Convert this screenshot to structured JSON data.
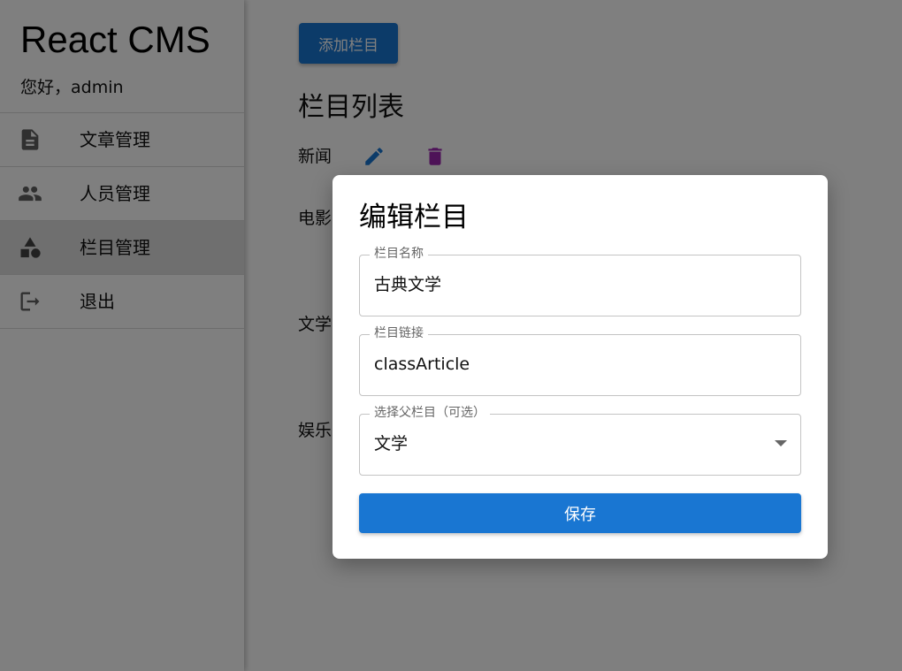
{
  "app": {
    "brand": "React CMS",
    "greeting": "您好，admin"
  },
  "sidebar": {
    "items": [
      {
        "label": "文章管理",
        "icon": "article-icon",
        "active": false
      },
      {
        "label": "人员管理",
        "icon": "people-icon",
        "active": false
      },
      {
        "label": "栏目管理",
        "icon": "category-icon",
        "active": true
      },
      {
        "label": "退出",
        "icon": "logout-icon",
        "active": false
      }
    ]
  },
  "main": {
    "add_button_label": "添加栏目",
    "section_title": "栏目列表",
    "categories": [
      {
        "name": "新闻"
      },
      {
        "name": "电影"
      },
      {
        "name": "文学"
      },
      {
        "name": "娱乐"
      }
    ]
  },
  "dialog": {
    "title": "编辑栏目",
    "name_field": {
      "label": "栏目名称",
      "value": "古典文学"
    },
    "link_field": {
      "label": "栏目链接",
      "value": "classArticle"
    },
    "parent_field": {
      "label": "选择父栏目（可选）",
      "value": "文学"
    },
    "save_label": "保存"
  },
  "colors": {
    "primary": "#1976d2",
    "edit_icon": "#1976d2",
    "delete_icon": "#9c27b0",
    "backdrop": "rgba(0,0,0,0.5)"
  }
}
